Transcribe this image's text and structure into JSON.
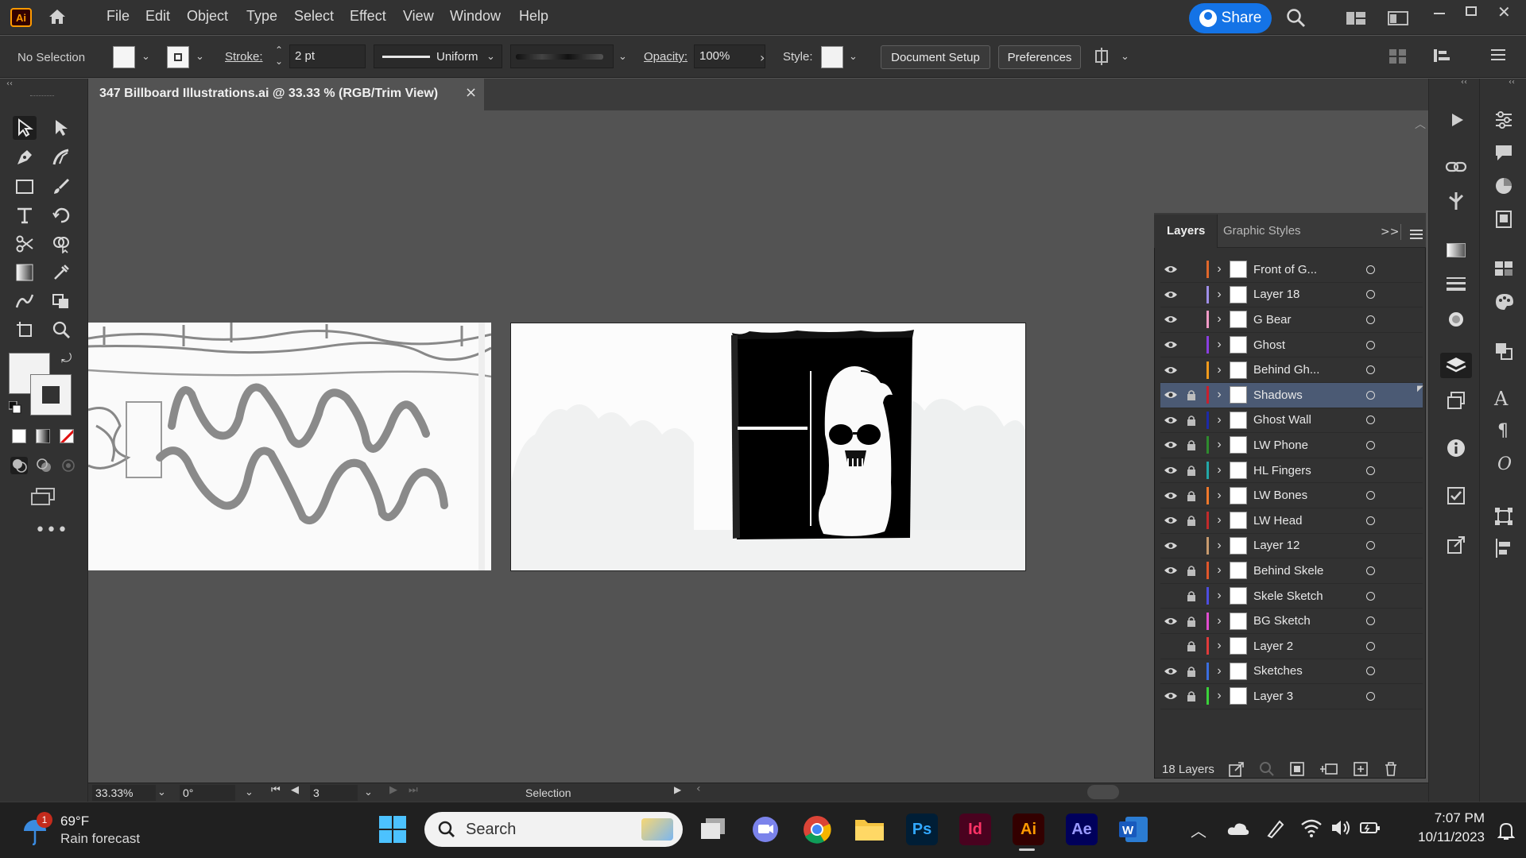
{
  "app": {
    "name": "Adobe Illustrator",
    "logo_text": "Ai",
    "accent": "#ff9a00"
  },
  "menu": [
    "File",
    "Edit",
    "Object",
    "Type",
    "Select",
    "Effect",
    "View",
    "Window",
    "Help"
  ],
  "share_label": "Share",
  "control_bar": {
    "selection_label": "No Selection",
    "stroke_label": "Stroke:",
    "stroke_value": "2 pt",
    "stroke_profile": "Uniform",
    "opacity_label": "Opacity:",
    "opacity_value": "100%",
    "style_label": "Style:",
    "document_setup": "Document Setup",
    "preferences": "Preferences"
  },
  "document_tab": {
    "title": "347 Billboard Illustrations.ai @ 33.33 % (RGB/Trim View)",
    "close": "×"
  },
  "layers_panel": {
    "tabs": [
      "Layers",
      "Graphic Styles"
    ],
    "layers": [
      {
        "name": "Front of G...",
        "color": "#e0672b",
        "visible": true,
        "locked": false,
        "selected": false
      },
      {
        "name": "Layer 18",
        "color": "#9f8ee8",
        "visible": true,
        "locked": false,
        "selected": false
      },
      {
        "name": "G Bear",
        "color": "#f29ac6",
        "visible": true,
        "locked": false,
        "selected": false
      },
      {
        "name": "Ghost",
        "color": "#8a3ee0",
        "visible": true,
        "locked": false,
        "selected": false
      },
      {
        "name": "Behind Gh...",
        "color": "#f19a1c",
        "visible": true,
        "locked": false,
        "selected": false
      },
      {
        "name": "Shadows",
        "color": "#c91f2d",
        "visible": true,
        "locked": true,
        "selected": true
      },
      {
        "name": "Ghost Wall",
        "color": "#1c2aa8",
        "visible": true,
        "locked": true,
        "selected": false
      },
      {
        "name": "LW Phone",
        "color": "#2e8b2e",
        "visible": true,
        "locked": true,
        "selected": false
      },
      {
        "name": "HL Fingers",
        "color": "#22a7a7",
        "visible": true,
        "locked": true,
        "selected": false
      },
      {
        "name": "LW Bones",
        "color": "#f0782b",
        "visible": true,
        "locked": true,
        "selected": false
      },
      {
        "name": "LW Head",
        "color": "#c22a2a",
        "visible": true,
        "locked": true,
        "selected": false
      },
      {
        "name": "Layer 12",
        "color": "#c79a6e",
        "visible": true,
        "locked": false,
        "selected": false
      },
      {
        "name": "Behind Skele",
        "color": "#e0562b",
        "visible": true,
        "locked": true,
        "selected": false
      },
      {
        "name": "Skele Sketch",
        "color": "#4d4de0",
        "visible": false,
        "locked": true,
        "selected": false
      },
      {
        "name": "BG Sketch",
        "color": "#e04ccf",
        "visible": true,
        "locked": true,
        "selected": false
      },
      {
        "name": "Layer 2",
        "color": "#e03a3a",
        "visible": false,
        "locked": true,
        "selected": false
      },
      {
        "name": "Sketches",
        "color": "#3a6ee0",
        "visible": true,
        "locked": true,
        "selected": false
      },
      {
        "name": "Layer 3",
        "color": "#3ad13a",
        "visible": true,
        "locked": true,
        "selected": false
      }
    ],
    "count_label": "18 Layers"
  },
  "status_bar": {
    "zoom": "33.33%",
    "rotation": "0°",
    "artboard": "3",
    "tool": "Selection"
  },
  "taskbar": {
    "weather_temp": "69°F",
    "weather_desc": "Rain forecast",
    "notification_count": "1",
    "search_placeholder": "Search",
    "time": "7:07 PM",
    "date": "10/11/2023",
    "apps": [
      {
        "label": "Ps",
        "bg": "#001e36",
        "fg": "#31a8ff"
      },
      {
        "label": "Id",
        "bg": "#49021f",
        "fg": "#ff3366"
      },
      {
        "label": "Ai",
        "bg": "#330000",
        "fg": "#ff9a00"
      },
      {
        "label": "Ae",
        "bg": "#00005b",
        "fg": "#9999ff"
      }
    ]
  }
}
